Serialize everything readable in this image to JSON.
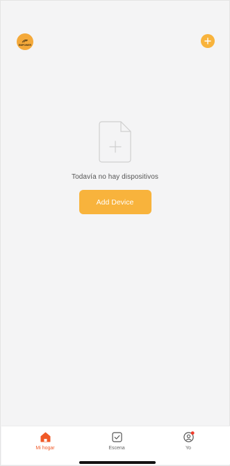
{
  "header": {
    "logo_text": "EMPOWER",
    "add_icon": "plus-circle-icon"
  },
  "empty_state": {
    "icon": "document-add-icon",
    "message": "Todavía no hay dispositivos",
    "button_label": "Add Device"
  },
  "tabbar": {
    "tabs": [
      {
        "label": "Mi hogar",
        "icon": "home-icon",
        "active": true
      },
      {
        "label": "Escena",
        "icon": "checkbox-icon",
        "active": false
      },
      {
        "label": "Yo",
        "icon": "user-icon",
        "active": false,
        "notification_dot": true
      }
    ]
  },
  "colors": {
    "accent": "#f8b33c",
    "active_tab": "#f05a28",
    "background": "#f4f4f5",
    "notification": "#f03a2a"
  }
}
